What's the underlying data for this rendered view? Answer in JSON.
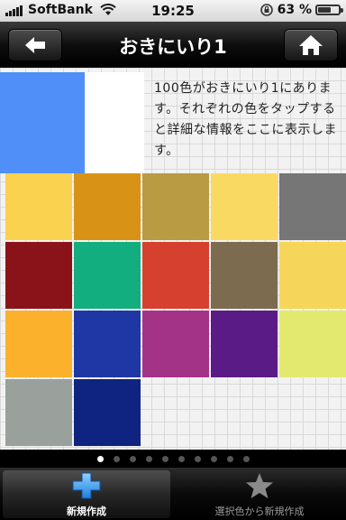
{
  "status_bar": {
    "carrier": "SoftBank",
    "time": "19:25",
    "battery_percent": "63 %",
    "battery_level": 0.63
  },
  "nav": {
    "title": "おきにいり1",
    "back_icon": "back-arrow-icon",
    "home_icon": "home-icon"
  },
  "selection": {
    "color": "#4f8ff7",
    "description": "100色がおきにいり1にあります。それぞれの色をタップすると詳細な情報をここに表示します。"
  },
  "swatches": [
    "#fbd150",
    "#d89316",
    "#b99b44",
    "#fad963",
    "#767676",
    "#891318",
    "#13ae80",
    "#d6402f",
    "#7c6b4e",
    "#f6d65a",
    "#fbb12b",
    "#1f36a5",
    "#a33387",
    "#5b1b86",
    "#e3e86e",
    "#9aa19d",
    "#0f2380"
  ],
  "pager": {
    "count": 10,
    "active": 0
  },
  "tabs": [
    {
      "label": "新規作成",
      "icon": "plus-icon",
      "active": true
    },
    {
      "label": "選択色から新規作成",
      "icon": "star-icon",
      "active": false
    }
  ]
}
